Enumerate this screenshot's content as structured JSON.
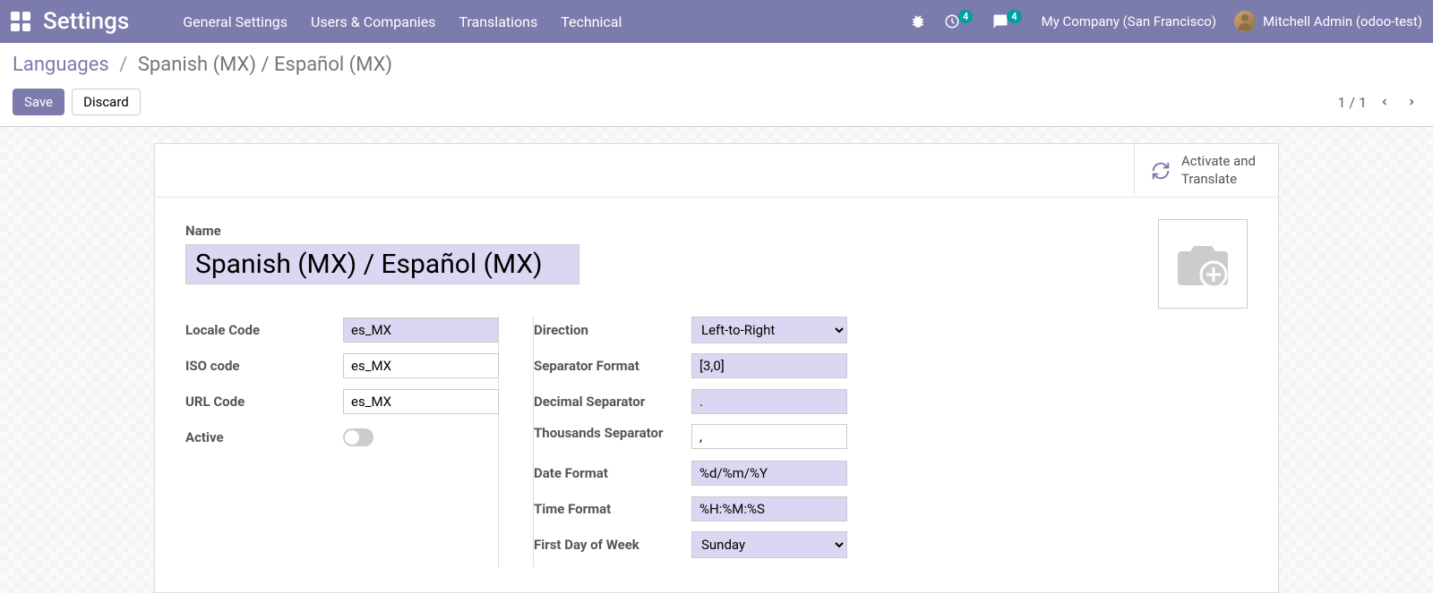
{
  "navbar": {
    "title": "Settings",
    "menu": [
      "General Settings",
      "Users & Companies",
      "Translations",
      "Technical"
    ],
    "clock_badge": "4",
    "discuss_badge": "4",
    "company": "My Company (San Francisco)",
    "user": "Mitchell Admin (odoo-test)"
  },
  "breadcrumb": {
    "parent": "Languages",
    "current": "Spanish (MX) / Español (MX)"
  },
  "buttons": {
    "save": "Save",
    "discard": "Discard"
  },
  "pager": {
    "value": "1 / 1"
  },
  "stat_button": "Activate and Translate",
  "labels": {
    "name": "Name",
    "locale_code": "Locale Code",
    "iso_code": "ISO code",
    "url_code": "URL Code",
    "active": "Active",
    "direction": "Direction",
    "separator_format": "Separator Format",
    "decimal_separator": "Decimal Separator",
    "thousands_separator": "Thousands Separator",
    "date_format": "Date Format",
    "time_format": "Time Format",
    "first_day_of_week": "First Day of Week"
  },
  "values": {
    "name": "Spanish (MX) / Español (MX)",
    "locale_code": "es_MX",
    "iso_code": "es_MX",
    "url_code": "es_MX",
    "direction": "Left-to-Right",
    "separator_format": "[3,0]",
    "decimal_separator": ".",
    "thousands_separator": ",",
    "date_format": "%d/%m/%Y",
    "time_format": "%H:%M:%S",
    "first_day_of_week": "Sunday"
  }
}
